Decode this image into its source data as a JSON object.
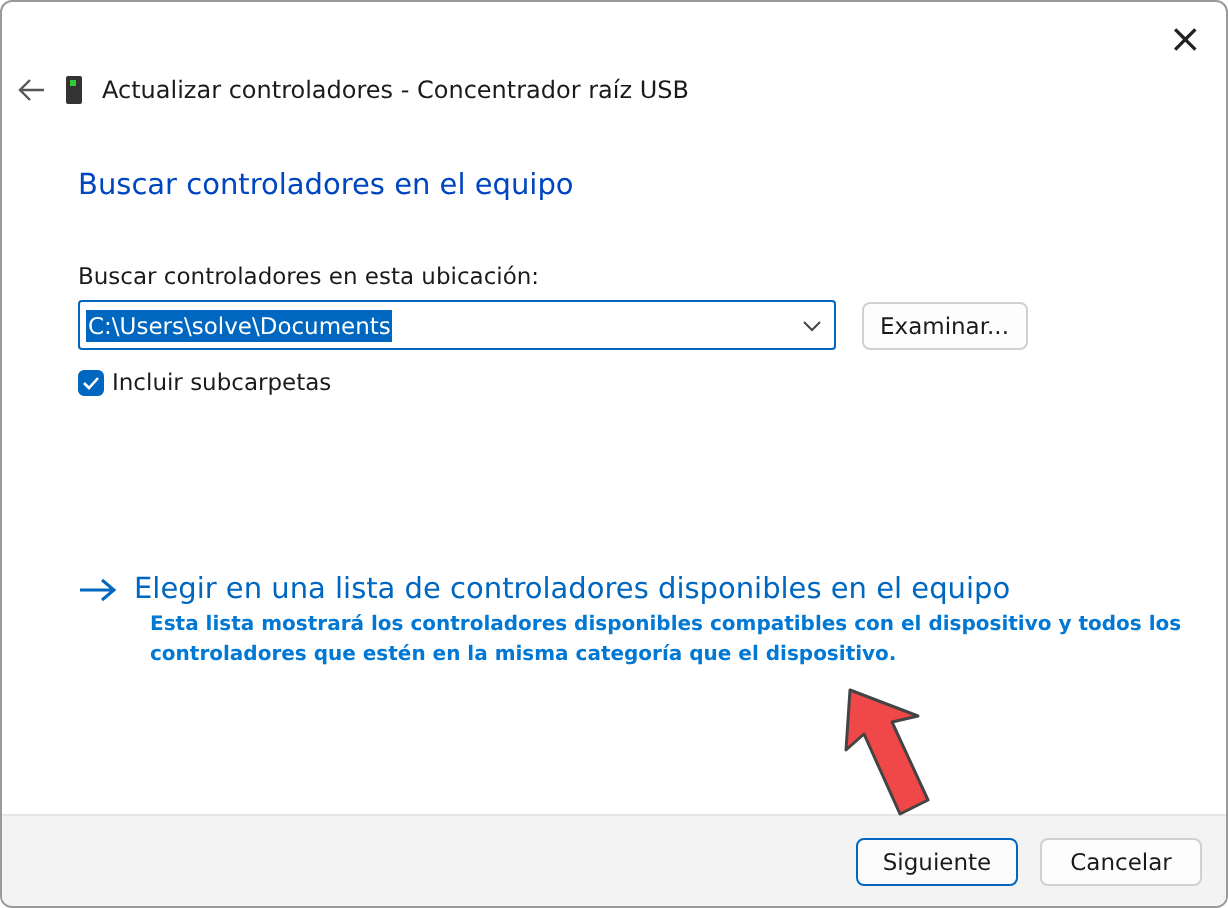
{
  "window": {
    "title": "Actualizar controladores - Concentrador raíz USB",
    "close": "×"
  },
  "heading": "Buscar controladores en el equipo",
  "location": {
    "label": "Buscar controladores en esta ubicación:",
    "value": "C:\\Users\\solve\\Documents",
    "browse": "Examinar..."
  },
  "include_subfolders": {
    "label": "Incluir subcarpetas",
    "checked": true
  },
  "pick_from_list": {
    "title": "Elegir en una lista de controladores disponibles en el equipo",
    "description": "Esta lista mostrará los controladores disponibles compatibles con el dispositivo y todos los controladores que estén en la misma categoría que el dispositivo."
  },
  "buttons": [
    {
      "label": "Siguiente",
      "kind": "primary"
    },
    {
      "label": "Cancelar",
      "kind": "secondary"
    }
  ]
}
